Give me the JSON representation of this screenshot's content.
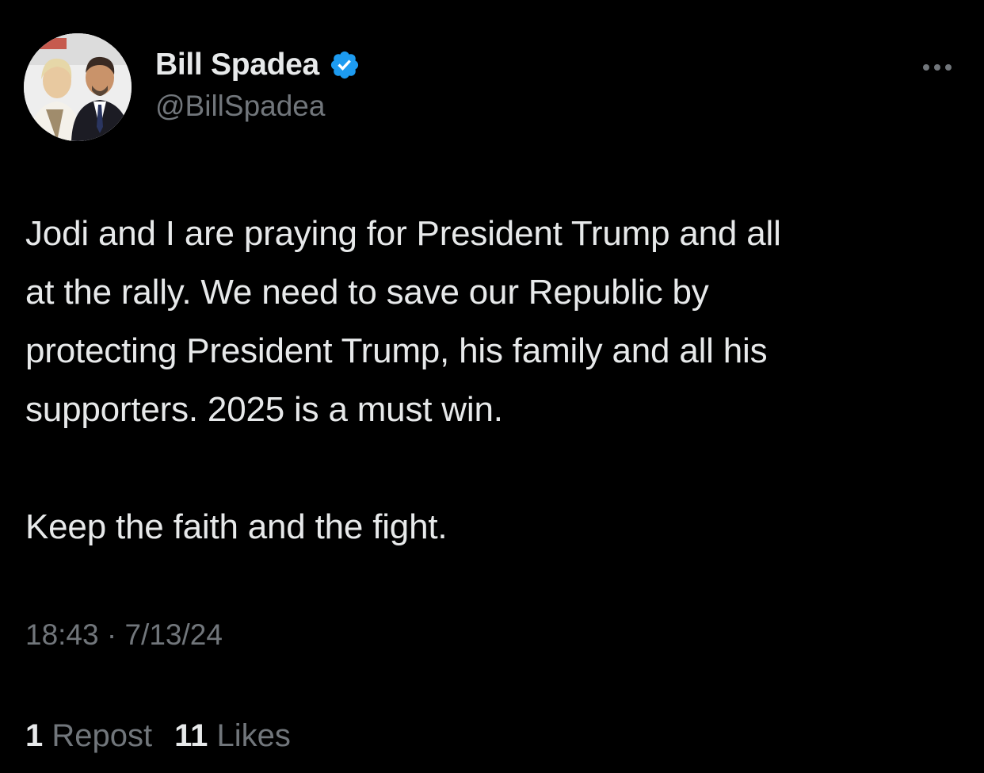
{
  "author": {
    "display_name": "Bill Spadea",
    "handle": "@BillSpadea",
    "verified": true,
    "avatar_icon": "profile-photo",
    "badge_icon": "verified-checkmark-icon",
    "badge_color": "#1d9bf0"
  },
  "more_menu_icon": "ellipsis-icon",
  "tweet": {
    "lines": [
      "Jodi and I are praying for President Trump and all",
      "at the rally. We need to save our Republic by",
      "protecting President Trump, his family and all his",
      "supporters. 2025 is a must win.",
      "Keep the faith and the fight."
    ],
    "timestamp": "18:43 · 7/13/24"
  },
  "engagement": {
    "reposts": {
      "count": "1",
      "label": "Repost"
    },
    "likes": {
      "count": "11",
      "label": "Likes"
    }
  },
  "colors": {
    "background": "#000000",
    "primary_text": "#e7e9ea",
    "secondary_text": "#71767b"
  }
}
